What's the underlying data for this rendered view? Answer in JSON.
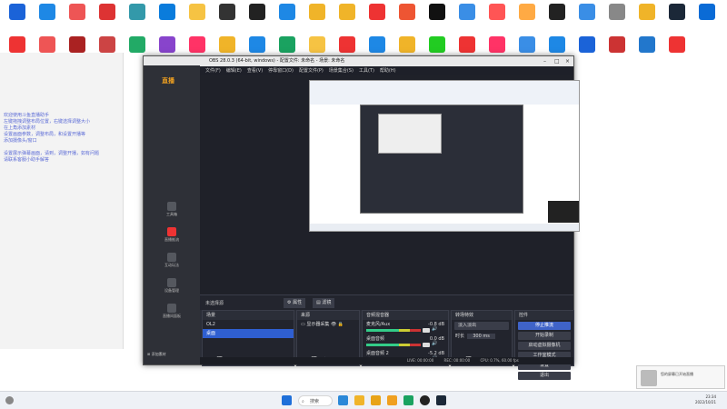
{
  "desktop": {
    "icons_row1": [
      {
        "label": "",
        "color": "#1b63d8"
      },
      {
        "label": "",
        "color": "#1e88e5"
      },
      {
        "label": "",
        "color": "#e55"
      },
      {
        "label": "",
        "color": "#d33"
      },
      {
        "label": "",
        "color": "#39a"
      },
      {
        "label": "",
        "color": "#0a7cdc"
      },
      {
        "label": "",
        "color": "#f6c343"
      },
      {
        "label": "",
        "color": "#333"
      },
      {
        "label": "",
        "color": "#222"
      },
      {
        "label": "",
        "color": "#1e88e5"
      },
      {
        "label": "",
        "color": "#f0b429"
      },
      {
        "label": "",
        "color": "#f0b429"
      },
      {
        "label": "",
        "color": "#e33"
      },
      {
        "label": "",
        "color": "#e53"
      },
      {
        "label": "",
        "color": "#111"
      },
      {
        "label": "",
        "color": "#3a8ee6"
      },
      {
        "label": "",
        "color": "#f55"
      },
      {
        "label": "",
        "color": "#fa4"
      },
      {
        "label": "",
        "color": "#222"
      },
      {
        "label": "",
        "color": "#3a8ee6"
      },
      {
        "label": "",
        "color": "#888"
      },
      {
        "label": "",
        "color": "#f0b429"
      },
      {
        "label": "",
        "color": "#1b2838"
      },
      {
        "label": "",
        "color": "#0a6bd6"
      }
    ],
    "icons_row2": [
      {
        "label": "",
        "color": "#e33"
      },
      {
        "label": "",
        "color": "#e55"
      },
      {
        "label": "",
        "color": "#a22"
      },
      {
        "label": "",
        "color": "#c44"
      },
      {
        "label": "",
        "color": "#2a6"
      },
      {
        "label": "",
        "color": "#8844cc"
      },
      {
        "label": "",
        "color": "#f36"
      },
      {
        "label": "",
        "color": "#f0b429"
      },
      {
        "label": "",
        "color": "#1e88e5"
      },
      {
        "label": "",
        "color": "#1aa260"
      },
      {
        "label": "",
        "color": "#f6c343"
      },
      {
        "label": "",
        "color": "#e33"
      },
      {
        "label": "",
        "color": "#1e88e5"
      },
      {
        "label": "",
        "color": "#f0b429"
      },
      {
        "label": "",
        "color": "#2c2"
      },
      {
        "label": "",
        "color": "#e33"
      },
      {
        "label": "",
        "color": "#f36"
      },
      {
        "label": "",
        "color": "#3a8ee6"
      },
      {
        "label": "",
        "color": "#1e88e5"
      },
      {
        "label": "",
        "color": "#1b63d8"
      },
      {
        "label": "",
        "color": "#c33"
      },
      {
        "label": "",
        "color": "#2277cc"
      },
      {
        "label": "",
        "color": "#e33"
      }
    ]
  },
  "note_lines": [
    "欢迎使用斗鱼直播助手",
    "左键拖拽调整布局位置，右键选择调整大小",
    "在上角添加素材",
    "设置画面参数，调整布局，和设置开播等",
    "添加摄像头/窗口",
    "",
    "设置展示弹幕画面，请到，调整开播，如有问题",
    "请联系客服小助手解答"
  ],
  "obs": {
    "title": "OBS 28.0.3 (64-bit, windows) - 配置文件: 未命名 - 场景: 未命名",
    "menu": [
      "文件(F)",
      "编辑(E)",
      "查看(V)",
      "停靠窗口(D)",
      "配置文件(P)",
      "场景集合(S)",
      "工具(T)",
      "帮助(H)"
    ],
    "source_none": "未选择源",
    "props_btn": "属性",
    "filters_btn": "滤镜",
    "docks": {
      "scenes": {
        "title": "场景",
        "items": [
          "OL2",
          "桌面"
        ],
        "selected": 1
      },
      "sources": {
        "title": "来源",
        "items": [
          "显示器采集"
        ]
      },
      "mixer": {
        "title": "音频混音器",
        "channels": [
          {
            "name": "麦克风/Aux",
            "db": "-0.8 dB"
          },
          {
            "name": "桌面音频",
            "db": "0.0 dB"
          },
          {
            "name": "桌面音频 2",
            "db": "-5.2 dB"
          }
        ]
      },
      "transitions": {
        "title": "转场特效",
        "type": "淡入淡出",
        "duration_label": "时长",
        "duration": "300 ms"
      },
      "controls": {
        "title": "控件",
        "buttons": [
          "停止推流",
          "开始录制",
          "启动虚拟摄像机",
          "工作室模式",
          "设置",
          "退出"
        ]
      }
    },
    "status": {
      "live": "LIVE: 00:00:00",
      "rec": "REC: 00:00:00",
      "cpu": "CPU: 0.7%, 60.00 fps"
    }
  },
  "app": {
    "logo": "直播",
    "nav": [
      "工具箱",
      "直播推流",
      "互动玩法",
      "设备管理",
      "直播间面板"
    ],
    "add_label": "添加素材"
  },
  "taskbar": {
    "search": "搜索",
    "time": "23:34",
    "date": "2022/10/21"
  },
  "toast": {
    "text": "您的屏幕已开始直播"
  }
}
